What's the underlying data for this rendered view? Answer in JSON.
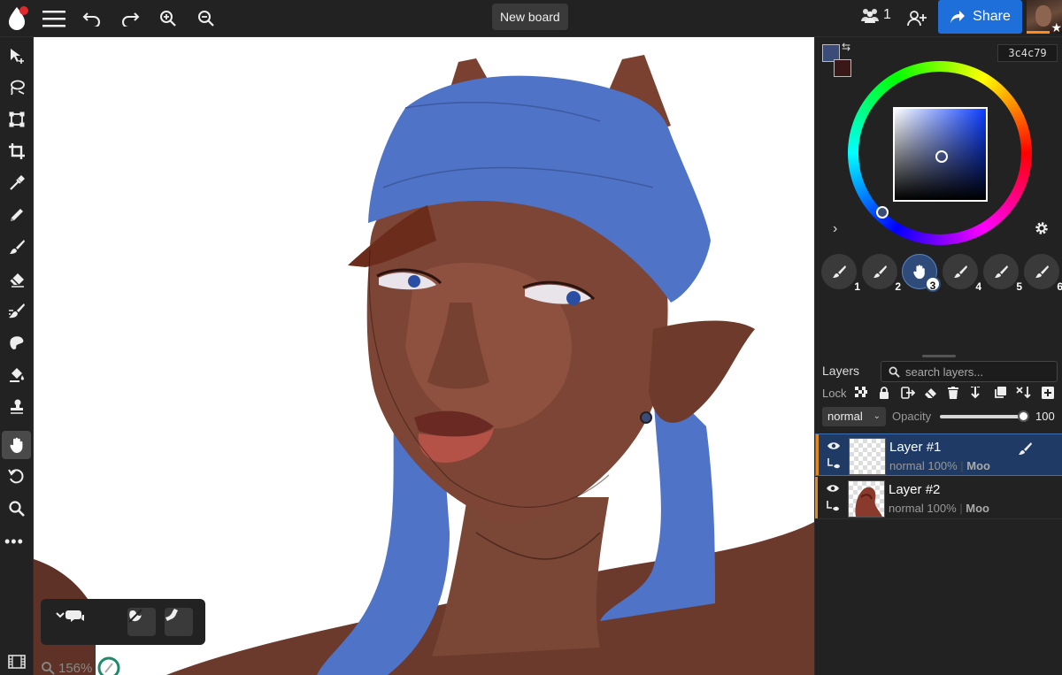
{
  "topbar": {
    "board_title": "New board",
    "user_count": "1",
    "share_label": "Share"
  },
  "toolbar": {
    "tools": [
      "move-tool",
      "lasso-tool",
      "transform-tool",
      "crop-tool",
      "eyedropper-tool",
      "pencil-tool",
      "brush-tool",
      "eraser-tool",
      "smudge-tool",
      "blur-tool",
      "fill-tool",
      "stamp-tool",
      "hand-tool",
      "rotate-tool",
      "zoom-tool"
    ],
    "active_tool": "hand-tool"
  },
  "canvas": {
    "zoom_label": "156%"
  },
  "color": {
    "hex": "3c4c79",
    "primary": "#3c4c79",
    "secondary": "#3a1818"
  },
  "brush_slots": [
    "1",
    "2",
    "3",
    "4",
    "5",
    "6"
  ],
  "layers_panel": {
    "title": "Layers",
    "search_placeholder": "search layers...",
    "lock_label": "Lock",
    "blend_mode": "normal",
    "opacity_label": "Opacity",
    "opacity_value": "100",
    "opacity_fraction": 1.0,
    "items": [
      {
        "name": "Layer #1",
        "blend": "normal",
        "opacity": "100%",
        "owner": "Moo",
        "selected": true
      },
      {
        "name": "Layer #2",
        "blend": "normal",
        "opacity": "100%",
        "owner": "Moo",
        "selected": false
      }
    ]
  }
}
